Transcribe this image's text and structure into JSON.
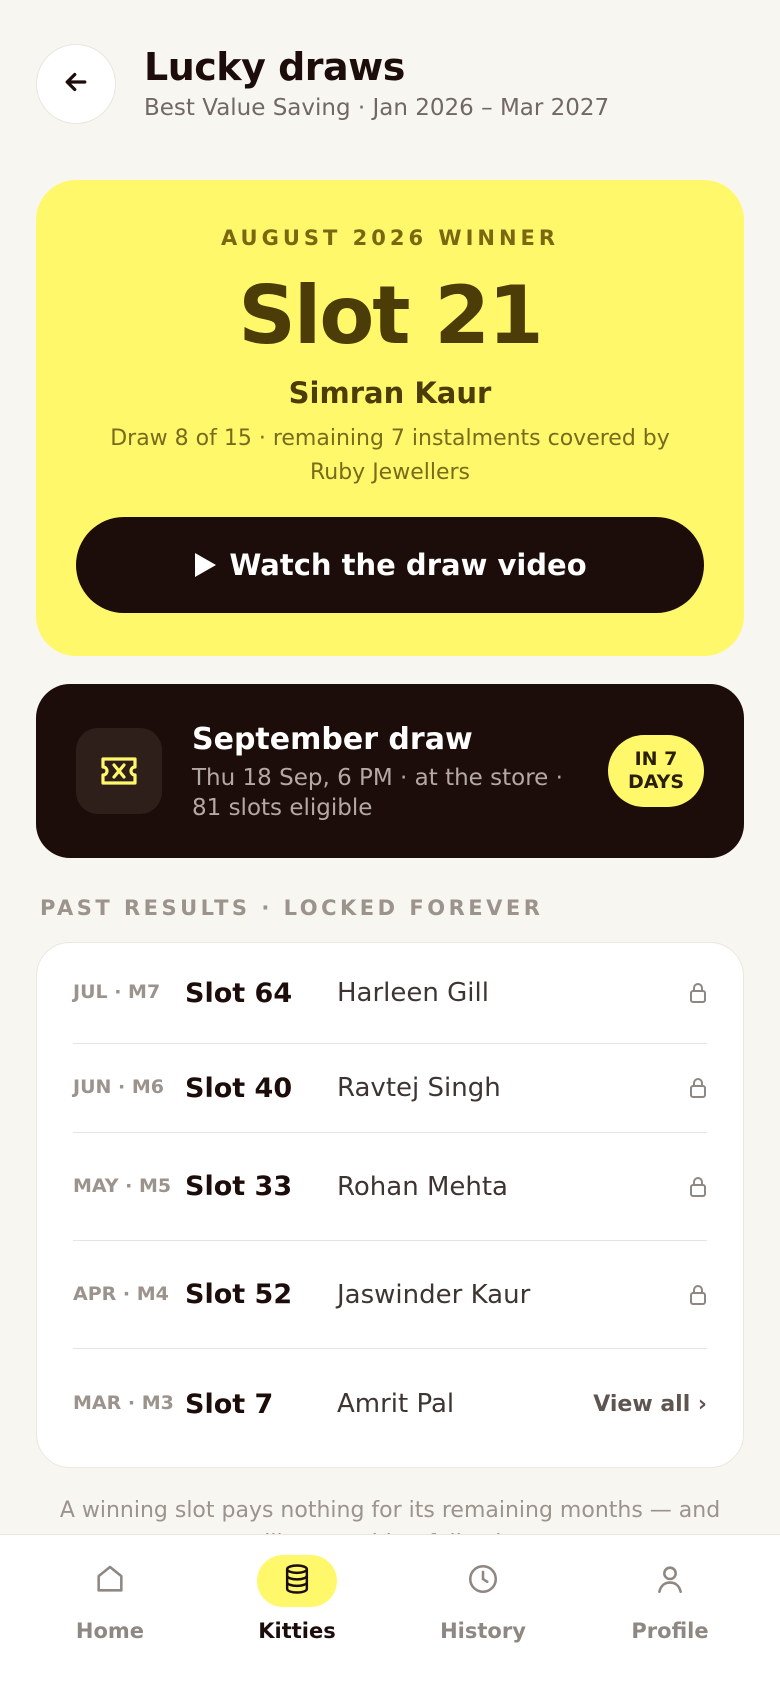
{
  "header": {
    "title": "Lucky draws",
    "subtitle": "Best Value Saving · Jan 2026 – Mar 2027",
    "back_icon": "arrow-left-icon"
  },
  "winner": {
    "eyebrow": "AUGUST 2026 WINNER",
    "slot": "Slot 21",
    "name": "Simran Kaur",
    "description": "Draw 8 of 15 · remaining 7 instalments covered by Ruby Jewellers",
    "watch_button": "Watch the draw video",
    "background_color": "#fff86b"
  },
  "next_draw": {
    "title": "September draw",
    "detail": "Thu 18 Sep, 6 PM · at the store · 81 slots eligible",
    "badge": "IN 7 DAYS",
    "icon": "ticket-icon"
  },
  "past_results": {
    "label": "PAST RESULTS · LOCKED FOREVER",
    "rows": [
      {
        "date": "JUL · M7",
        "slot": "Slot 64",
        "name": "Harleen Gill",
        "status_icon": "lock-icon"
      },
      {
        "date": "JUN · M6",
        "slot": "Slot 40",
        "name": "Ravtej Singh",
        "status_icon": "lock-icon"
      },
      {
        "date": "MAY · M5",
        "slot": "Slot 33",
        "name": "Rohan Mehta",
        "status_icon": "lock-icon"
      },
      {
        "date": "APR · M4",
        "slot": "Slot 52",
        "name": "Jaswinder Kaur",
        "status_icon": "lock-icon"
      },
      {
        "date": "MAR · M3",
        "slot": "Slot 7",
        "name": "Amrit Pal"
      }
    ],
    "view_all": "View all ›"
  },
  "footnote": "A winning slot pays nothing for its remaining months — and still gets paid at full value.",
  "nav": {
    "items": [
      {
        "label": "Home",
        "icon": "home-icon"
      },
      {
        "label": "Kitties",
        "icon": "coins-icon",
        "active": true
      },
      {
        "label": "History",
        "icon": "clock-icon"
      },
      {
        "label": "Profile",
        "icon": "user-icon"
      }
    ]
  }
}
